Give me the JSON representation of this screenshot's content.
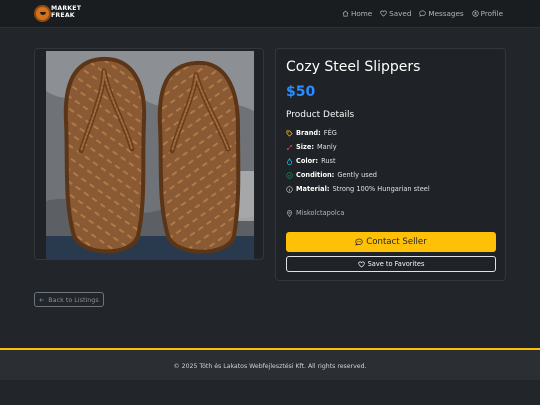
{
  "nav": {
    "logo_line1": "MARKET",
    "logo_line2": "FREAK",
    "links": [
      {
        "label": "Home",
        "icon": "house-icon"
      },
      {
        "label": "Saved",
        "icon": "heart-icon"
      },
      {
        "label": "Messages",
        "icon": "chat-icon"
      },
      {
        "label": "Profile",
        "icon": "person-circle-icon"
      }
    ]
  },
  "product": {
    "title": "Cozy Steel Slippers",
    "price": "$50",
    "details_heading": "Product Details",
    "details": [
      {
        "label": "Brand:",
        "value": "FÉG",
        "icon": "tag-icon",
        "icon_color": "#ffc107"
      },
      {
        "label": "Size:",
        "value": "Manly",
        "icon": "arrows-diagonal-icon",
        "icon_color": "#dc3545"
      },
      {
        "label": "Color:",
        "value": "Rust",
        "icon": "droplet-icon",
        "icon_color": "#0dcaf0"
      },
      {
        "label": "Condition:",
        "value": "Gently used",
        "icon": "check-circle-icon",
        "icon_color": "#198754"
      },
      {
        "label": "Material:",
        "value": "Strong 100% Hungarian steel",
        "icon": "info-circle-icon",
        "icon_color": "#adb5bd"
      }
    ],
    "location": "Miskolctapolca",
    "contact_label": "Contact Seller",
    "favorite_label": "Save to Favorites"
  },
  "back_label": "Back to Listings",
  "footer": {
    "text": "© 2025 Tóth és Lakatos Webfejlesztési Kft. All rights reserved."
  },
  "colors": {
    "accent": "#ffc107",
    "price": "#2b8cff",
    "background": "#222529"
  }
}
